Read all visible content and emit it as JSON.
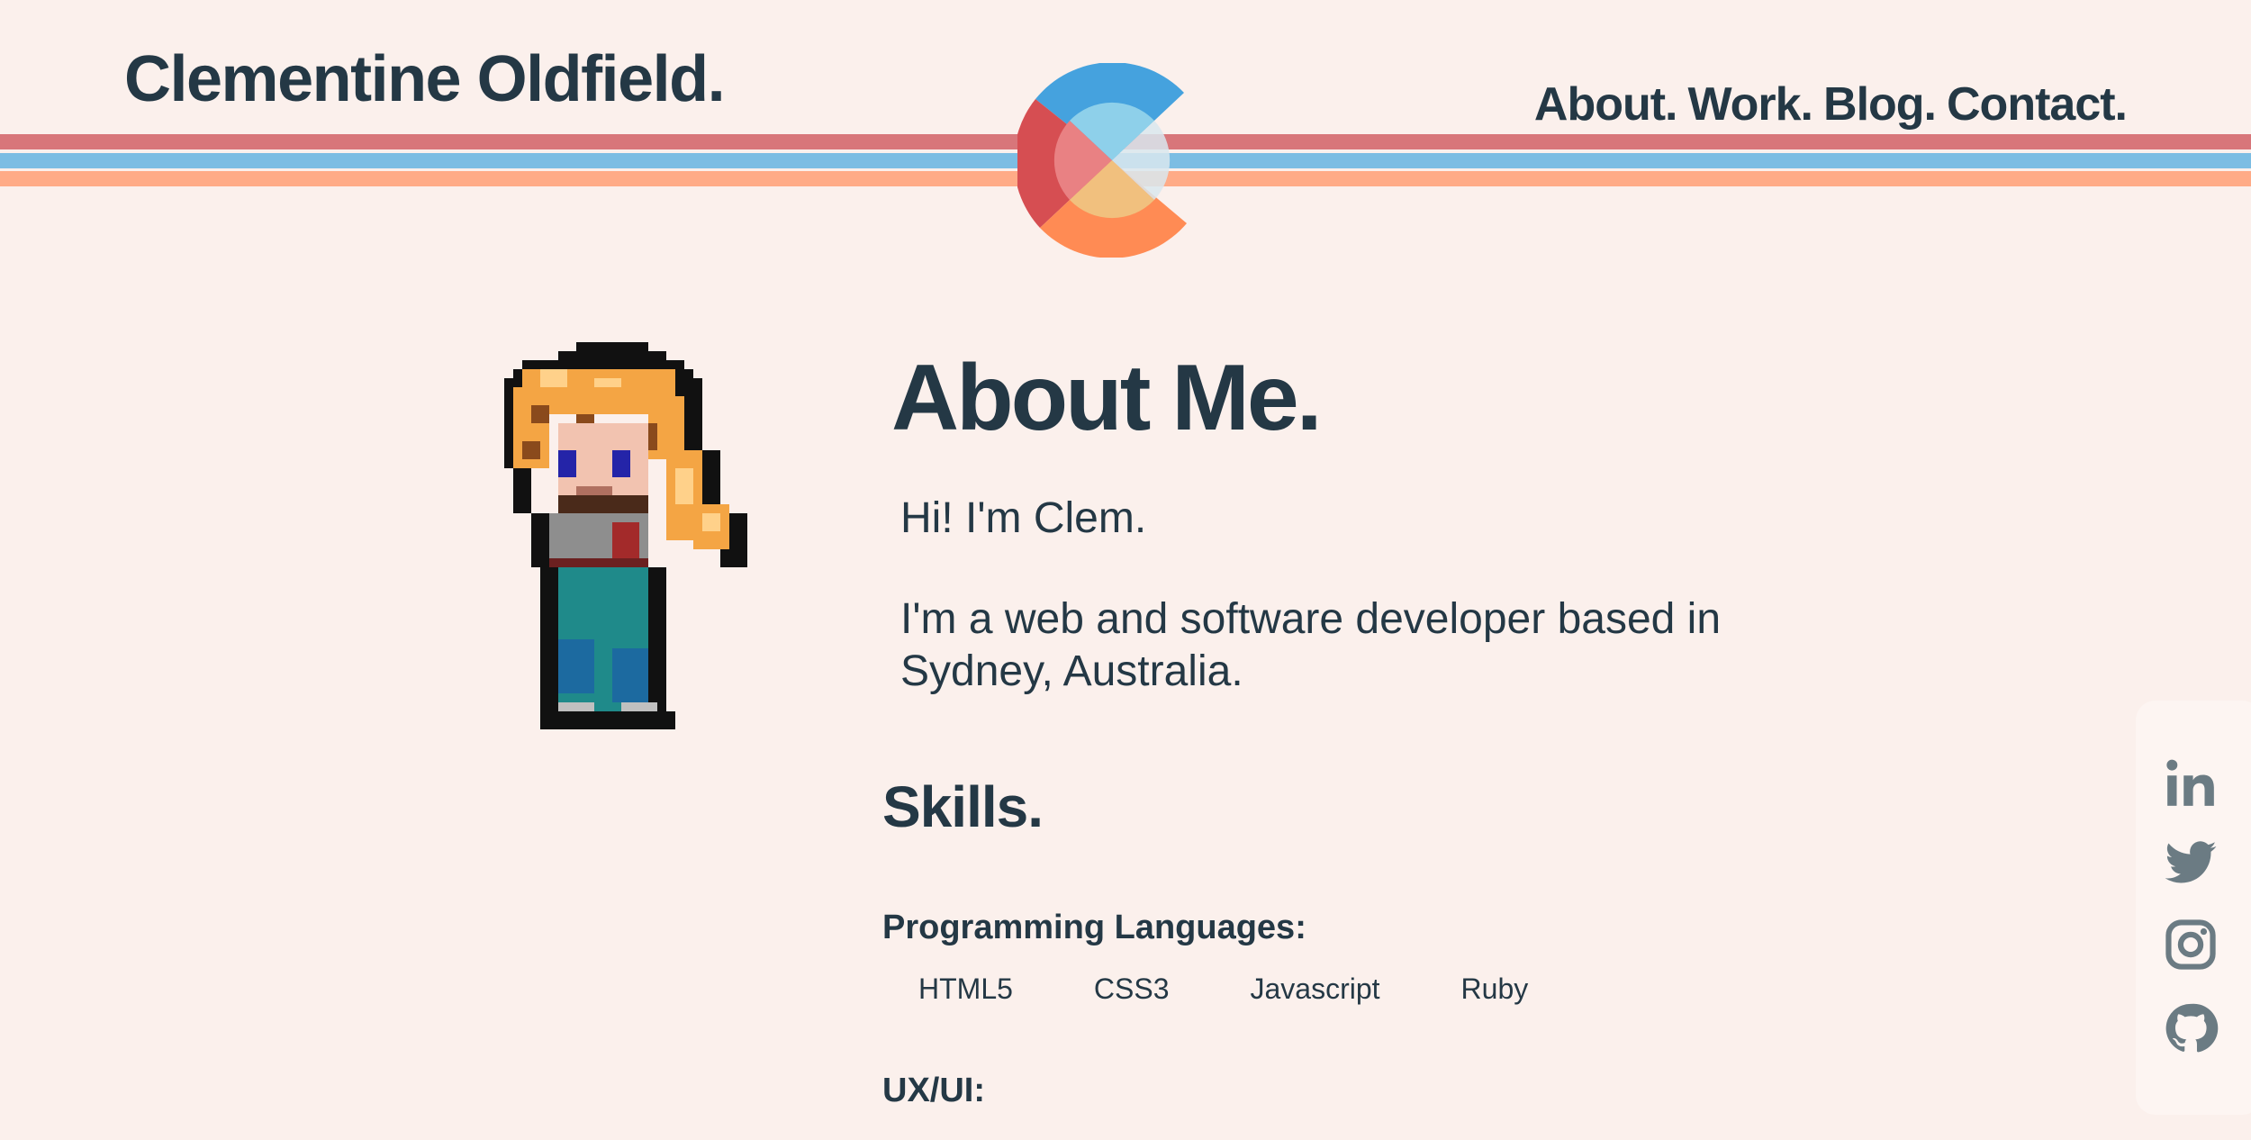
{
  "header": {
    "site_title": "Clementine Oldfield.",
    "nav": [
      "About.",
      "Work.",
      "Blog.",
      "Contact."
    ]
  },
  "about": {
    "heading": "About Me.",
    "greeting": "Hi! I'm Clem.",
    "bio": "I'm a web and software developer based in Sydney, Australia."
  },
  "skills": {
    "heading": "Skills.",
    "categories": [
      {
        "label": "Programming Languages:",
        "items": [
          "HTML5",
          "CSS3",
          "Javascript",
          "Ruby"
        ]
      },
      {
        "label": "UX/UI:"
      }
    ]
  },
  "social": {
    "icons": [
      "linkedin-icon",
      "twitter-icon",
      "instagram-icon",
      "github-icon"
    ]
  },
  "colors": {
    "background": "#fbf0ec",
    "text": "#243845",
    "stripe_red": "#d8767a",
    "stripe_blue": "#7cbde3",
    "stripe_orange": "#ffab87",
    "icon_gray": "#6b7b83"
  }
}
